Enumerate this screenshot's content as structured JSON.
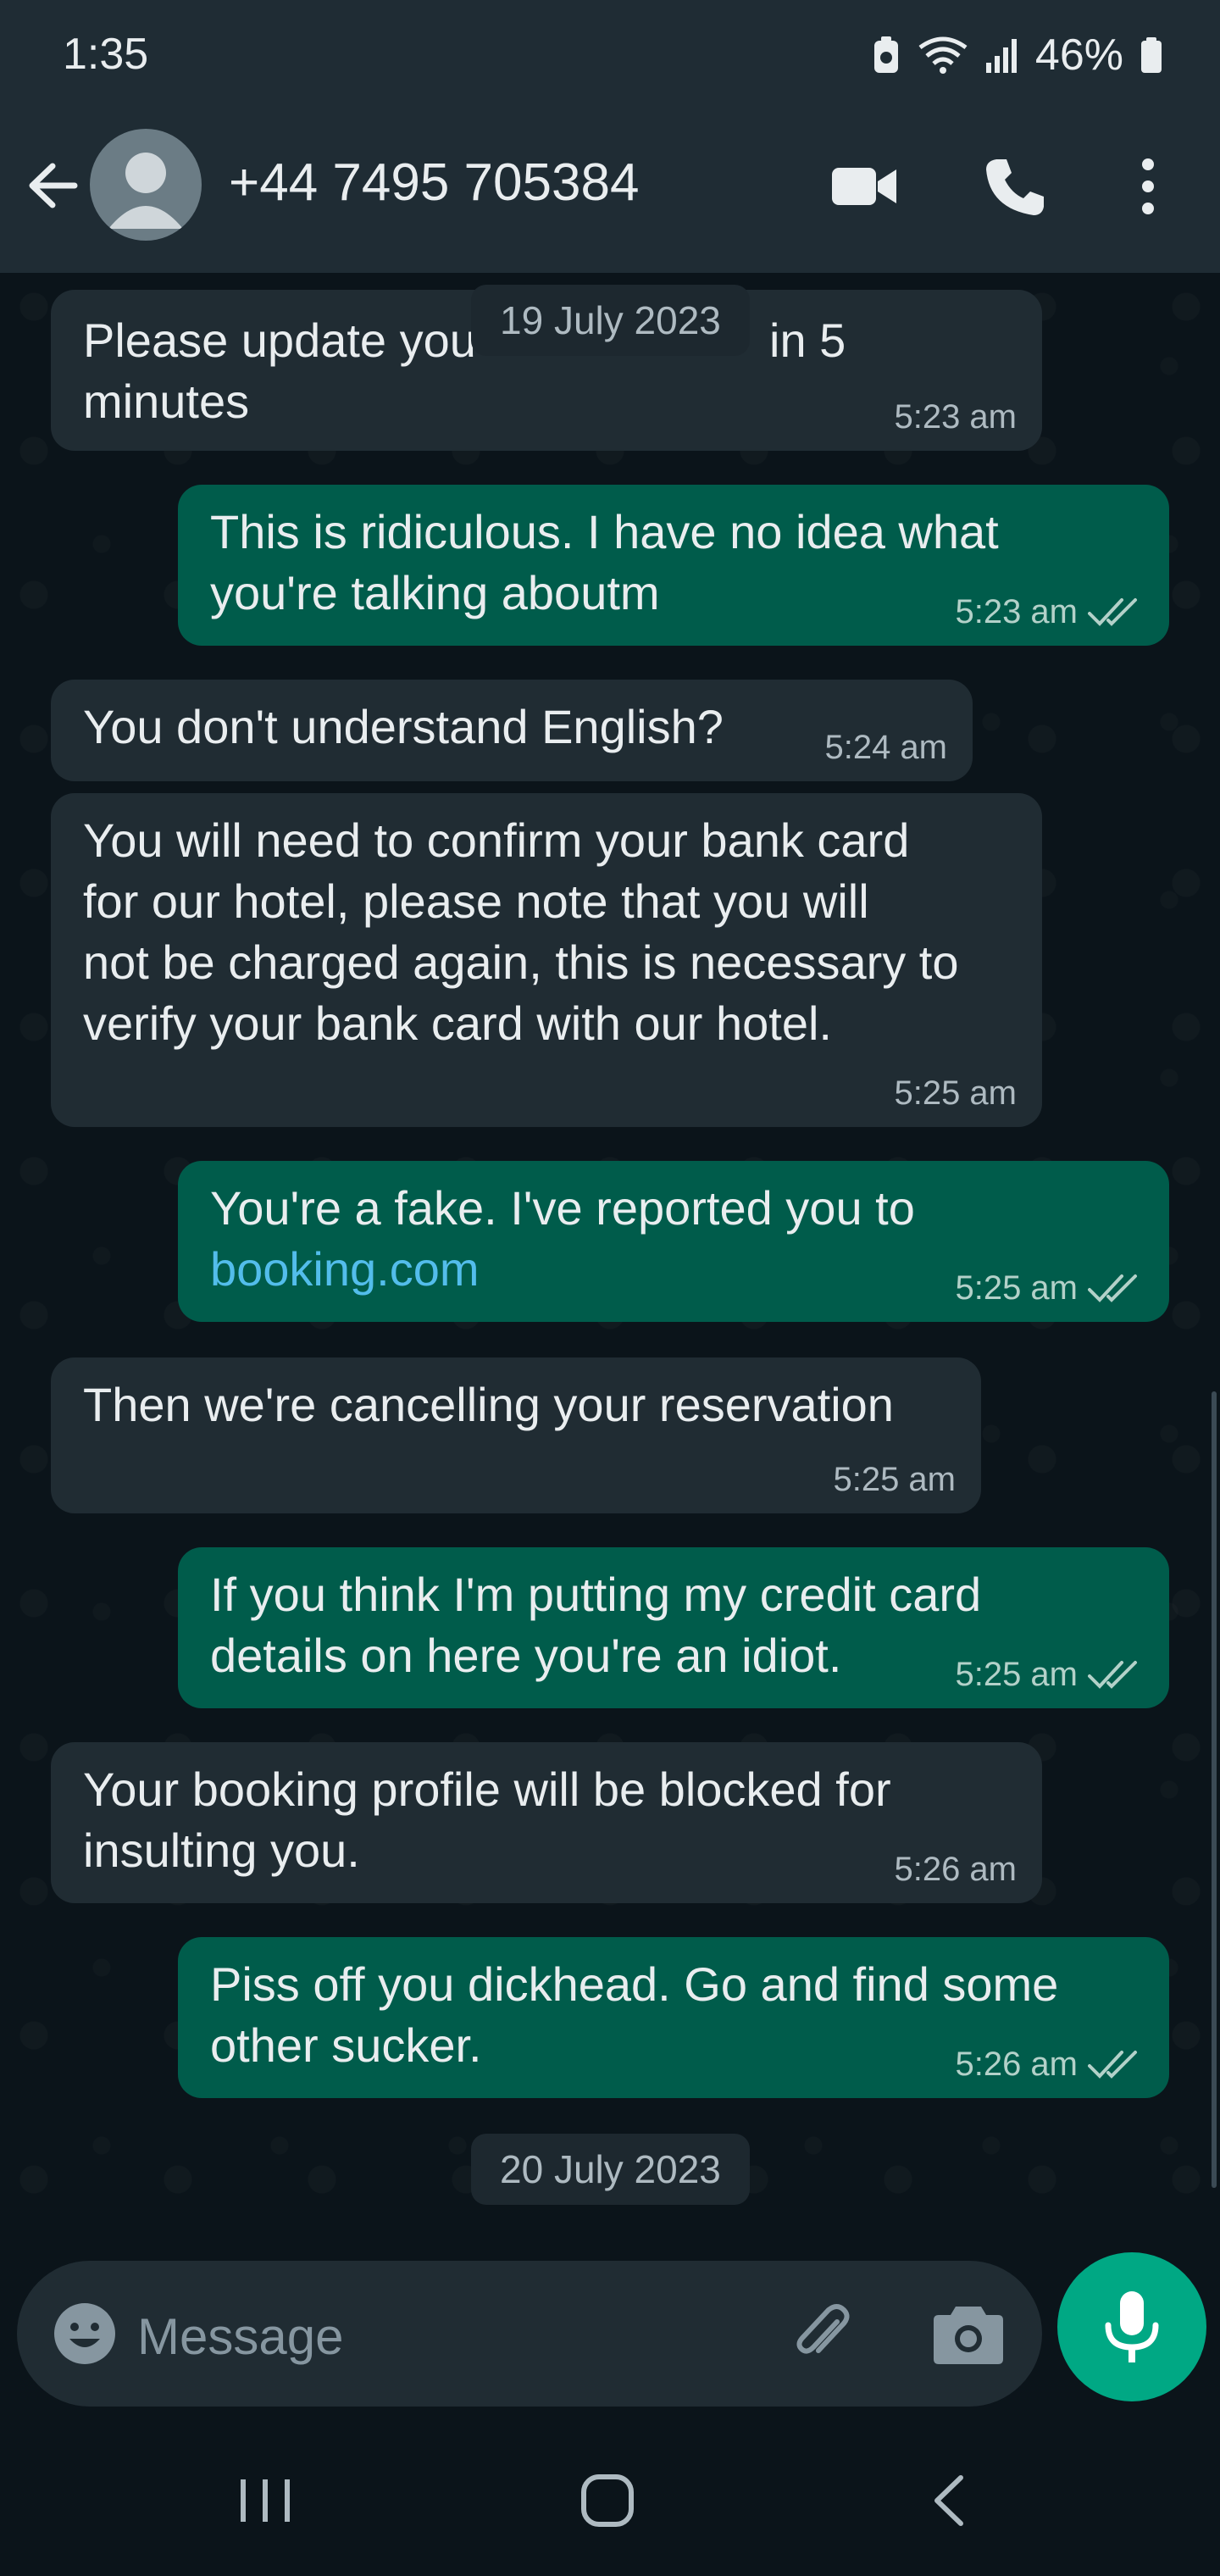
{
  "status_bar": {
    "time": "1:35",
    "battery": "46%"
  },
  "header": {
    "contact_name": "+44 7495 705384"
  },
  "chat": {
    "date_top": "19 July 2023",
    "date_bottom": "20 July 2023",
    "messages": [
      {
        "direction": "in",
        "text": "Please update your details within 5\nminutes",
        "visible_text_left": "Please update you",
        "visible_text_right": "in 5",
        "visible_text_line2": "minutes",
        "time": "5:23 am"
      },
      {
        "direction": "out",
        "text": "This is ridiculous. I have no idea what\nyou're talking aboutm",
        "time": "5:23 am",
        "status": "read"
      },
      {
        "direction": "in",
        "text": "You don't understand English?",
        "time": "5:24 am"
      },
      {
        "direction": "in",
        "text": "You will need to confirm your bank card\nfor our hotel, please note that you will\nnot be charged again, this is necessary to\nverify your bank card with our hotel.",
        "time": "5:25 am"
      },
      {
        "direction": "out",
        "text": "You're a fake. I've reported you to",
        "link": "booking.com",
        "time": "5:25 am",
        "status": "read"
      },
      {
        "direction": "in",
        "text": "Then we're cancelling your reservation",
        "time": "5:25 am"
      },
      {
        "direction": "out",
        "text": "If you think I'm putting my credit card\ndetails on here you're an idiot.",
        "time": "5:25 am",
        "status": "read"
      },
      {
        "direction": "in",
        "text": "Your booking profile will be blocked for\ninsulting you.",
        "time": "5:26 am"
      },
      {
        "direction": "out",
        "text": "Piss off you dickhead. Go and find some\nother sucker.",
        "time": "5:26 am",
        "status": "read"
      }
    ]
  },
  "input": {
    "placeholder": "Message"
  },
  "colors": {
    "background": "#0b141a",
    "header": "#1f2c34",
    "incoming_bubble": "#202c33",
    "outgoing_bubble": "#005c4b",
    "accent": "#00a884",
    "link": "#53bdeb"
  },
  "icons": [
    "back-arrow-icon",
    "avatar-icon",
    "video-call-icon",
    "phone-call-icon",
    "more-options-icon",
    "double-check-icon",
    "emoji-icon",
    "attach-icon",
    "camera-icon",
    "mic-icon"
  ]
}
